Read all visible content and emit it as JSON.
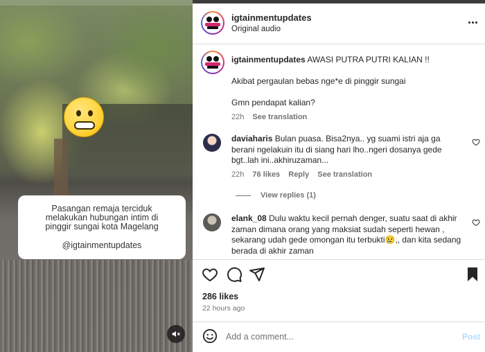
{
  "video": {
    "overlay_line1": "Pasangan remaja terciduk",
    "overlay_line2": "melakukan hubungan intim di",
    "overlay_line3": "pinggir sungai kota Magelang",
    "overlay_handle": "@igtainmentupdates",
    "mute_icon": "speaker-muted-icon"
  },
  "header": {
    "username": "igtainmentupdates",
    "subtitle": "Original audio"
  },
  "caption": {
    "username": "igtainmentupdates",
    "line1": "AWASI PUTRA PUTRI KALIAN !!",
    "line2": "Akibat pergaulan bebas nge*e di pinggir sungai",
    "line3": "Gmn pendapat kalian?",
    "time": "22h",
    "see_translation": "See translation"
  },
  "comments": [
    {
      "username": "daviaharis",
      "text": "Bulan puasa. Bisa2nya.. yg suami istri aja ga berani ngelakuin itu di siang hari lho..ngeri dosanya gede bgt..lah ini..akhiruzaman...",
      "time": "22h",
      "likes": "76 likes",
      "reply": "Reply",
      "see_translation": "See translation",
      "view_replies": "View replies (1)"
    },
    {
      "username": "elank_08",
      "text": "Dulu waktu kecil pernah denger, suatu saat di akhir zaman dimana orang yang maksiat sudah seperti hewan , sekarang udah gede omongan itu terbukti😢,, dan kita sedang berada di akhir zaman"
    }
  ],
  "footer": {
    "likes": "286 likes",
    "ago": "22 hours ago",
    "comment_placeholder": "Add a comment...",
    "post_label": "Post"
  },
  "icons": {
    "like": "heart-icon",
    "comment": "comment-icon",
    "share": "share-icon",
    "save": "bookmark-icon",
    "emoji": "emoji-icon",
    "more": "more-icon"
  }
}
